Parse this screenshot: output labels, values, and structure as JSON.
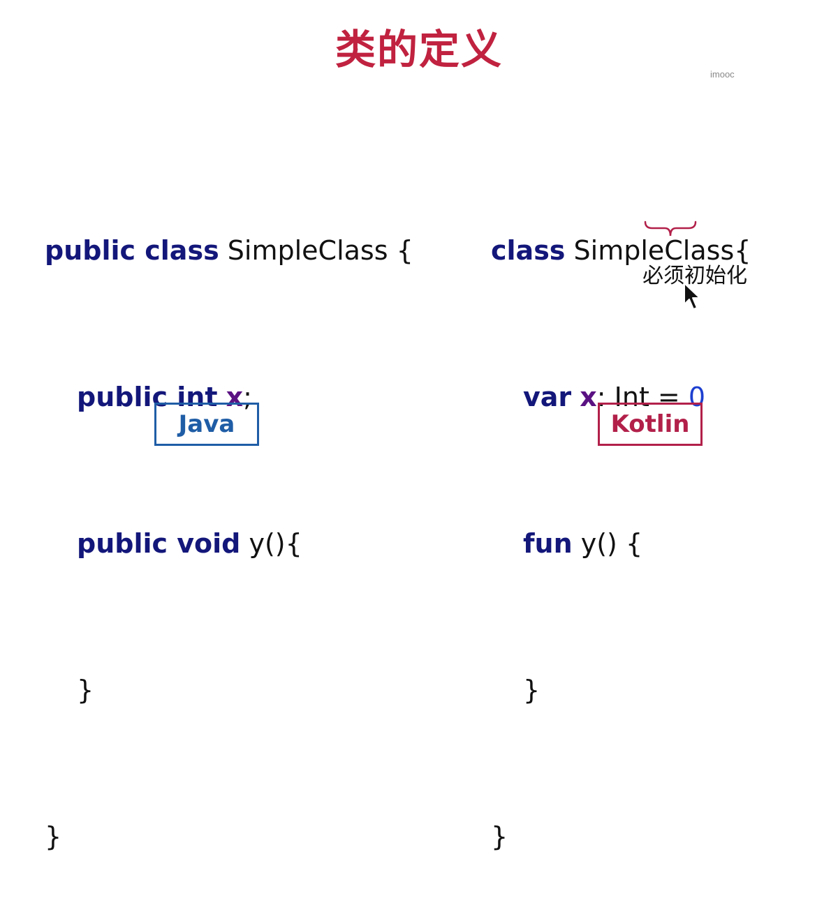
{
  "slide": {
    "title": "类的定义",
    "watermark": "imooc",
    "java": {
      "label": "Java",
      "lines": {
        "l1_kw": "public class",
        "l1_rest": " SimpleClass {",
        "l2_kw": "public int",
        "l2_var": "x",
        "l2_rest": ";",
        "l3_kw": "public void",
        "l3_rest": " y(){",
        "l4": "}",
        "l5": "}"
      }
    },
    "kotlin": {
      "label": "Kotlin",
      "lines": {
        "l1_kw": "class",
        "l1_rest": " SimpleClass{",
        "l2_kw": "var",
        "l2_var": "x",
        "l2_rest": ": Int = ",
        "l2_num": "0",
        "l3_kw": "fun",
        "l3_rest": " y() {",
        "l4": "}",
        "l5": "}"
      },
      "annotation": "必须初始化"
    }
  },
  "colors": {
    "title": "#c0223f",
    "keyword": "#13177a",
    "variable": "#5a1282",
    "number": "#1d3fd0",
    "java_tag": "#1f5da6",
    "kotlin_tag": "#b2204a"
  },
  "icons": [
    "curly-brace-icon",
    "mouse-cursor-icon"
  ]
}
